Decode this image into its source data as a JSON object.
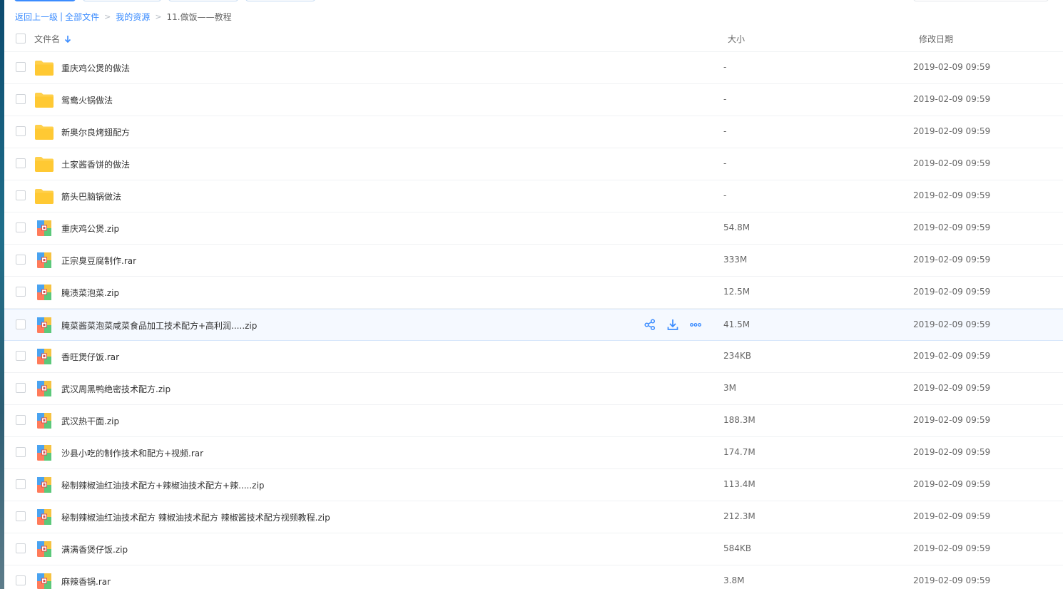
{
  "breadcrumb": {
    "back": "返回上一级",
    "all_files": "全部文件",
    "my_resources": "我的资源",
    "current": "11.做饭——教程"
  },
  "header": {
    "name_col": "文件名",
    "size_col": "大小",
    "date_col": "修改日期"
  },
  "files": [
    {
      "name": "重庆鸡公煲的做法",
      "type": "folder",
      "size": "-",
      "date": "2019-02-09 09:59"
    },
    {
      "name": "鸳鸯火锅做法",
      "type": "folder",
      "size": "-",
      "date": "2019-02-09 09:59"
    },
    {
      "name": "新奥尔良烤翅配方",
      "type": "folder",
      "size": "-",
      "date": "2019-02-09 09:59"
    },
    {
      "name": "土家酱香饼的做法",
      "type": "folder",
      "size": "-",
      "date": "2019-02-09 09:59"
    },
    {
      "name": "筋头巴脑锅做法",
      "type": "folder",
      "size": "-",
      "date": "2019-02-09 09:59"
    },
    {
      "name": "重庆鸡公煲.zip",
      "type": "archive",
      "size": "54.8M",
      "date": "2019-02-09 09:59"
    },
    {
      "name": "正宗臭豆腐制作.rar",
      "type": "archive",
      "size": "333M",
      "date": "2019-02-09 09:59"
    },
    {
      "name": "腌渍菜泡菜.zip",
      "type": "archive",
      "size": "12.5M",
      "date": "2019-02-09 09:59"
    },
    {
      "name": "腌菜酱菜泡菜咸菜食品加工技术配方+高利润.....zip",
      "type": "archive",
      "size": "41.5M",
      "date": "2019-02-09 09:59",
      "hover": true
    },
    {
      "name": "香旺煲仔饭.rar",
      "type": "archive",
      "size": "234KB",
      "date": "2019-02-09 09:59"
    },
    {
      "name": "武汉周黑鸭绝密技术配方.zip",
      "type": "archive",
      "size": "3M",
      "date": "2019-02-09 09:59"
    },
    {
      "name": "武汉热干面.zip",
      "type": "archive",
      "size": "188.3M",
      "date": "2019-02-09 09:59"
    },
    {
      "name": "沙县小吃的制作技术和配方+视频.rar",
      "type": "archive",
      "size": "174.7M",
      "date": "2019-02-09 09:59"
    },
    {
      "name": "秘制辣椒油红油技术配方+辣椒油技术配方+辣.....zip",
      "type": "archive",
      "size": "113.4M",
      "date": "2019-02-09 09:59"
    },
    {
      "name": "秘制辣椒油红油技术配方 辣椒油技术配方 辣椒酱技术配方视频教程.zip",
      "type": "archive",
      "size": "212.3M",
      "date": "2019-02-09 09:59"
    },
    {
      "name": "满满香煲仔饭.zip",
      "type": "archive",
      "size": "584KB",
      "date": "2019-02-09 09:59"
    },
    {
      "name": "麻辣香锅.rar",
      "type": "archive",
      "size": "3.8M",
      "date": "2019-02-09 09:59"
    }
  ],
  "icons": {
    "folder": "folder-icon",
    "archive": "archive-icon",
    "share": "share-icon",
    "download": "download-icon",
    "more": "more-icon",
    "sort": "sort-down-icon"
  },
  "colors": {
    "accent": "#3b8cff",
    "folder": "#ffd04b"
  }
}
